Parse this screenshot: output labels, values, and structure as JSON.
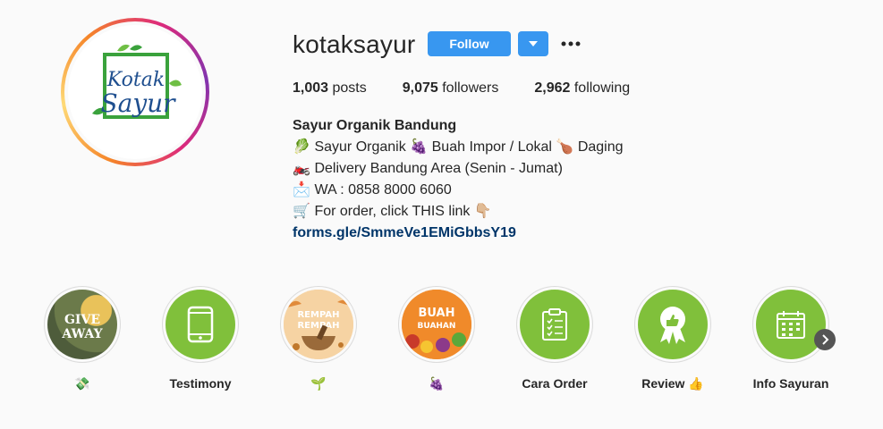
{
  "profile": {
    "username": "kotaksayur",
    "follow_label": "Follow",
    "avatar_text_line1": "Kotak",
    "avatar_text_line2": "Sayur"
  },
  "stats": {
    "posts_count": "1,003",
    "posts_label": " posts",
    "followers_count": "9,075",
    "followers_label": " followers",
    "following_count": "2,962",
    "following_label": " following"
  },
  "bio": {
    "name": "Sayur Organik Bandung",
    "line1": "Sayur Organik",
    "line1b": "Buah Impor / Lokal",
    "line1c": "Daging",
    "line2": "Delivery Bandung Area (Senin - Jumat)",
    "line3": "WA : 0858 8000 6060",
    "line4": "For order, click THIS link",
    "link": "forms.gle/SmmeVe1EMiGbbsY19",
    "emoji_leafy": "🥬",
    "emoji_grapes": "🍇",
    "emoji_meat": "🍗",
    "emoji_motor": "🏍️",
    "emoji_phone": "📩",
    "emoji_cart": "🛒",
    "emoji_point": "👇🏼"
  },
  "highlights": [
    {
      "label": "💸",
      "cover_text_top": "GIVE",
      "cover_text_bottom": "AWAY"
    },
    {
      "label": "Testimony"
    },
    {
      "label": "🌱",
      "cover_text_top": "REMPAH",
      "cover_text_bottom": "REMPAH"
    },
    {
      "label": "🍇",
      "cover_text_top": "BUAH",
      "cover_text_bottom": "BUAHAN"
    },
    {
      "label": "Cara Order"
    },
    {
      "label": "Review 👍"
    },
    {
      "label": "Info Sayuran"
    }
  ],
  "colors": {
    "follow_blue": "#3897f0",
    "highlight_green": "#80c03b",
    "link_blue": "#003569"
  },
  "icons": {
    "more": "more-horizontal-icon",
    "dropdown": "chevron-down-icon",
    "next": "chevron-right-icon"
  }
}
